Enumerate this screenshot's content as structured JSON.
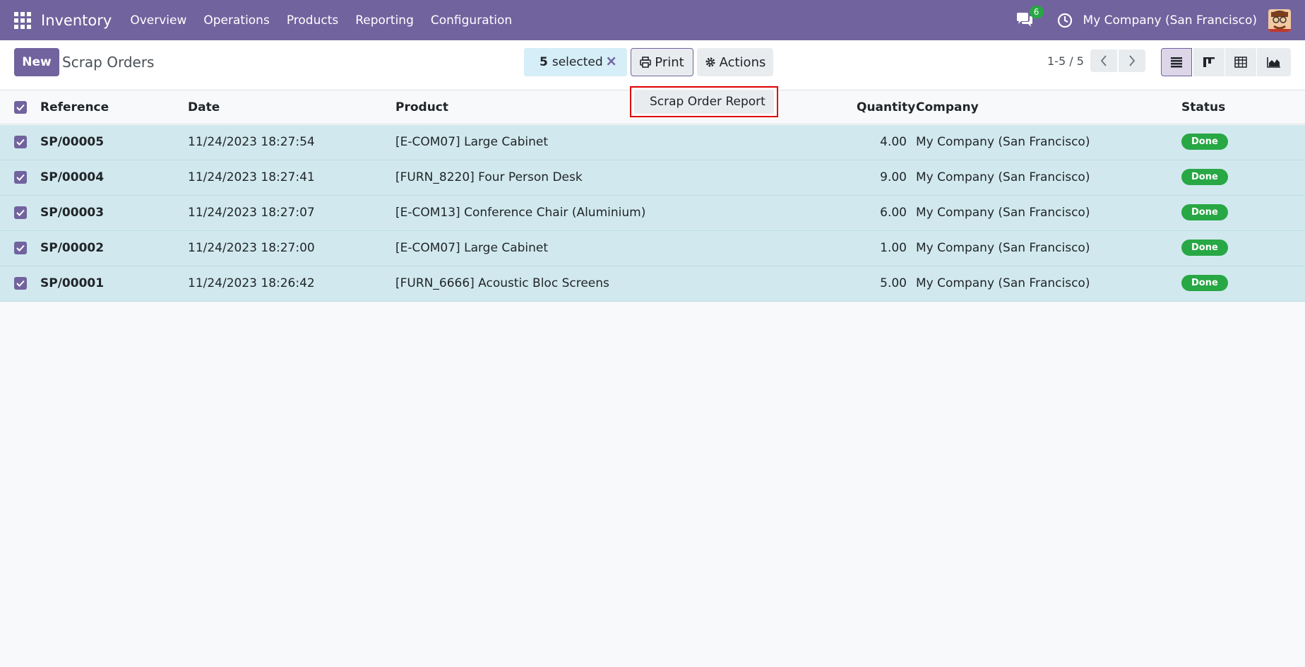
{
  "navbar": {
    "app_name": "Inventory",
    "menu": [
      "Overview",
      "Operations",
      "Products",
      "Reporting",
      "Configuration"
    ],
    "chat_count": "6",
    "company": "My Company (San Francisco)",
    "icons": [
      "apps-grid-icon",
      "chat-icon",
      "clock-icon",
      "avatar"
    ]
  },
  "control": {
    "new_label": "New",
    "title": "Scrap Orders",
    "selected_count": "5",
    "selected_text": "selected",
    "print_label": "Print",
    "actions_label": "Actions",
    "pager": "1-5 / 5"
  },
  "print_menu": {
    "items": [
      "Scrap Order Report"
    ]
  },
  "table": {
    "columns": [
      "Reference",
      "Date",
      "Product",
      "Quantity",
      "Company",
      "Status"
    ],
    "rows": [
      {
        "ref": "SP/00005",
        "date": "11/24/2023 18:27:54",
        "product": "[E-COM07] Large Cabinet",
        "qty": "4.00",
        "company": "My Company (San Francisco)",
        "status": "Done"
      },
      {
        "ref": "SP/00004",
        "date": "11/24/2023 18:27:41",
        "product": "[FURN_8220] Four Person Desk",
        "qty": "9.00",
        "company": "My Company (San Francisco)",
        "status": "Done"
      },
      {
        "ref": "SP/00003",
        "date": "11/24/2023 18:27:07",
        "product": "[E-COM13] Conference Chair (Aluminium)",
        "qty": "6.00",
        "company": "My Company (San Francisco)",
        "status": "Done"
      },
      {
        "ref": "SP/00002",
        "date": "11/24/2023 18:27:00",
        "product": "[E-COM07] Large Cabinet",
        "qty": "1.00",
        "company": "My Company (San Francisco)",
        "status": "Done"
      },
      {
        "ref": "SP/00001",
        "date": "11/24/2023 18:26:42",
        "product": "[FURN_6666] Acoustic Bloc Screens",
        "qty": "5.00",
        "company": "My Company (San Francisco)",
        "status": "Done"
      }
    ]
  },
  "colors": {
    "brand": "#71639e",
    "selected_row": "#d1e9ee",
    "status_done": "#28a745",
    "highlight": "#e00000"
  }
}
